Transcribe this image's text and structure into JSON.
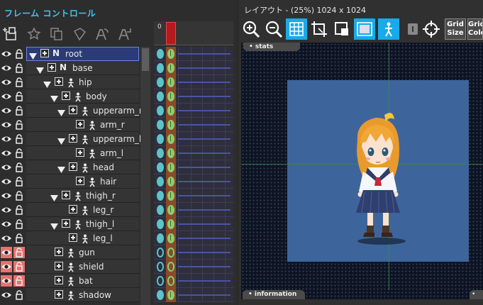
{
  "left_panel": {
    "title": "フレーム コントロール",
    "tools": [
      "add-part-icon",
      "add-effect-icon",
      "copy-frame-icon",
      "paste-icon",
      "rotate-a-icon",
      "reload-a-icon"
    ],
    "frame_number": "0"
  },
  "layers": [
    {
      "name": "root",
      "type": "N",
      "indent": 0,
      "expand": true,
      "selected": true,
      "highlight": false,
      "hollow": false
    },
    {
      "name": "base",
      "type": "N",
      "indent": 1,
      "expand": true,
      "selected": false,
      "highlight": false,
      "hollow": false
    },
    {
      "name": "hip",
      "type": "P",
      "indent": 2,
      "expand": true,
      "selected": false,
      "highlight": false,
      "hollow": false
    },
    {
      "name": "body",
      "type": "P",
      "indent": 3,
      "expand": true,
      "selected": false,
      "highlight": false,
      "hollow": false
    },
    {
      "name": "upperarm_r",
      "type": "P",
      "indent": 4,
      "expand": true,
      "selected": false,
      "highlight": false,
      "hollow": false
    },
    {
      "name": "arm_r",
      "type": "P",
      "indent": 5,
      "expand": false,
      "selected": false,
      "highlight": false,
      "hollow": false
    },
    {
      "name": "upperarm_l",
      "type": "P",
      "indent": 4,
      "expand": true,
      "selected": false,
      "highlight": false,
      "hollow": false
    },
    {
      "name": "arm_l",
      "type": "P",
      "indent": 5,
      "expand": false,
      "selected": false,
      "highlight": false,
      "hollow": false
    },
    {
      "name": "head",
      "type": "P",
      "indent": 4,
      "expand": true,
      "selected": false,
      "highlight": false,
      "hollow": false
    },
    {
      "name": "hair",
      "type": "P",
      "indent": 5,
      "expand": false,
      "selected": false,
      "highlight": false,
      "hollow": false
    },
    {
      "name": "thigh_r",
      "type": "P",
      "indent": 3,
      "expand": true,
      "selected": false,
      "highlight": false,
      "hollow": false
    },
    {
      "name": "leg_r",
      "type": "P",
      "indent": 4,
      "expand": false,
      "selected": false,
      "highlight": false,
      "hollow": false
    },
    {
      "name": "thigh_l",
      "type": "P",
      "indent": 3,
      "expand": true,
      "selected": false,
      "highlight": false,
      "hollow": false
    },
    {
      "name": "leg_l",
      "type": "P",
      "indent": 4,
      "expand": false,
      "selected": false,
      "highlight": false,
      "hollow": false
    },
    {
      "name": "gun",
      "type": "P",
      "indent": 2,
      "expand": false,
      "selected": false,
      "highlight": true,
      "hollow": true
    },
    {
      "name": "shield",
      "type": "P",
      "indent": 2,
      "expand": false,
      "selected": false,
      "highlight": true,
      "hollow": true
    },
    {
      "name": "bat",
      "type": "P",
      "indent": 2,
      "expand": false,
      "selected": false,
      "highlight": true,
      "hollow": true
    },
    {
      "name": "shadow",
      "type": "P",
      "indent": 2,
      "expand": false,
      "selected": false,
      "highlight": false,
      "hollow": false
    }
  ],
  "right_panel": {
    "title": "レイアウト - (25%)  1024 x 1024",
    "zoom": "25%",
    "canvas_size": "1024 x 1024",
    "tools": [
      "zoom-in-icon",
      "zoom-out-icon",
      "grid-toggle-icon",
      "crop-icon",
      "frame-icon",
      "bounds-icon",
      "person-icon",
      "lock-icon",
      "crosshair-icon"
    ],
    "grid_size_label": "Grid Size",
    "grid_color_label": "Grid Colo",
    "stats_label": "• stats",
    "information_label": "• information",
    "info2_label": "•"
  },
  "colors": {
    "accent": "#18aaea",
    "selection": "#2a3b78",
    "highlight": "#e9706e",
    "artboard": "#3d659b",
    "canvas": "#0d1424"
  }
}
